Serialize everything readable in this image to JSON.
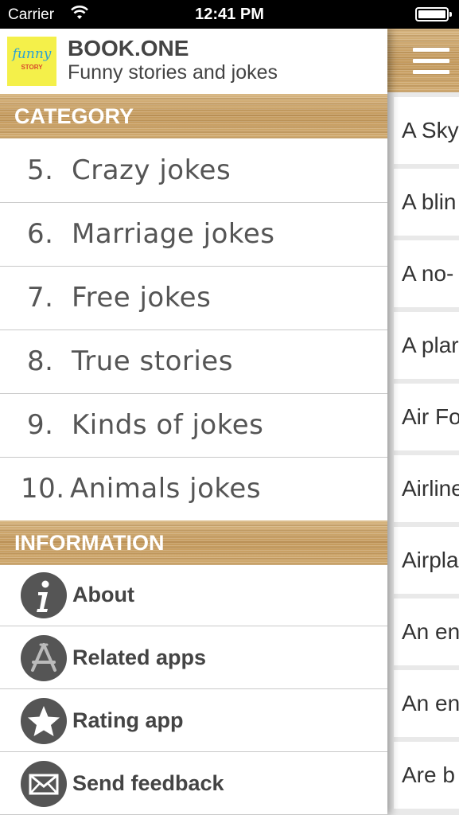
{
  "status_bar": {
    "carrier": "Carrier",
    "time": "12:41 PM"
  },
  "drawer": {
    "app_title": "BOOK.ONE",
    "app_subtitle": "Funny stories and jokes",
    "logo_text_top": "funny",
    "logo_text_bottom": "STORY",
    "category_header": "CATEGORY",
    "categories": [
      {
        "num": "5.",
        "label": "Crazy jokes"
      },
      {
        "num": "6.",
        "label": "Marriage jokes"
      },
      {
        "num": "7.",
        "label": "Free jokes"
      },
      {
        "num": "8.",
        "label": "True stories"
      },
      {
        "num": "9.",
        "label": "Kinds of jokes"
      },
      {
        "num": "10.",
        "label": "Animals jokes"
      }
    ],
    "information_header": "INFORMATION",
    "information": [
      {
        "label": "About",
        "icon": "info-icon"
      },
      {
        "label": "Related apps",
        "icon": "app-store-icon"
      },
      {
        "label": "Rating app",
        "icon": "star-icon"
      },
      {
        "label": "Send feedback",
        "icon": "envelope-icon"
      }
    ]
  },
  "main": {
    "items": [
      "A Sky",
      "A blin",
      "A no-",
      "A plar",
      "Air Fo",
      "Airline",
      "Airpla",
      "An en",
      "An en",
      "Are b"
    ]
  },
  "colors": {
    "wood": "#c9a267",
    "icon_bg": "#555555",
    "logo_bg": "#f4f04a"
  }
}
